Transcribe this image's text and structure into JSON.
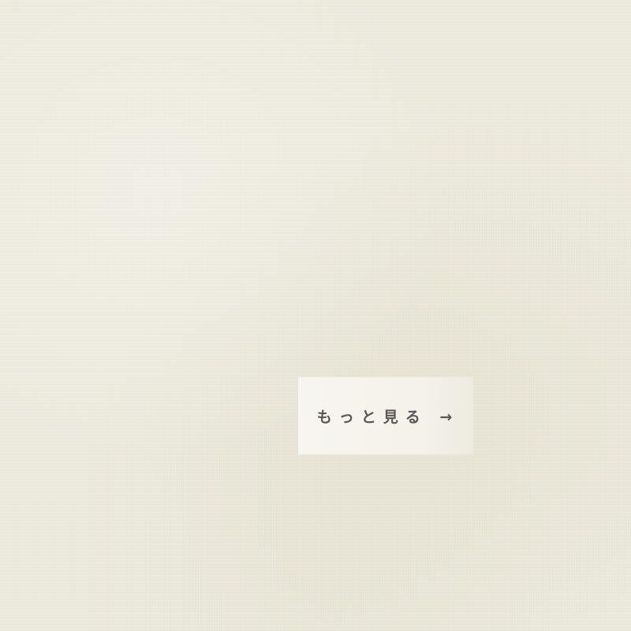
{
  "page": {
    "background_color": "#ECE9DD",
    "more_button": {
      "label": "もっと見る →",
      "text_color": "#5E5656"
    }
  }
}
